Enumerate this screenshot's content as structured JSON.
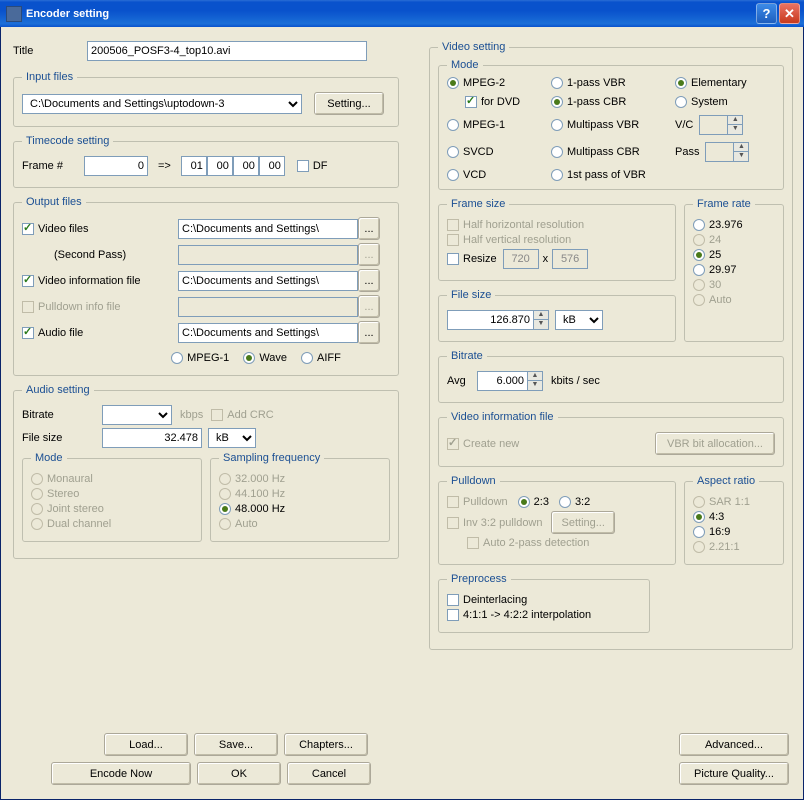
{
  "window": {
    "title": "Encoder setting"
  },
  "title_label": "Title",
  "title_value": "200506_POSF3-4_top10.avi",
  "input_files": {
    "legend": "Input files",
    "path": "C:\\Documents and Settings\\uptodown-3",
    "setting_btn": "Setting..."
  },
  "timecode": {
    "legend": "Timecode setting",
    "frame_label": "Frame #",
    "frame_value": "0",
    "arrow": "=>",
    "h": "01",
    "m": "00",
    "s": "00",
    "f": "00",
    "df_label": "DF"
  },
  "output_files": {
    "legend": "Output files",
    "video_files_label": "Video files",
    "second_pass": "(Second Pass)",
    "video_files_path": "C:\\Documents and Settings\\",
    "video_info_label": "Video information file",
    "video_info_path": "C:\\Documents and Settings\\",
    "pulldown_info_label": "Pulldown info file",
    "audio_file_label": "Audio file",
    "audio_file_path": "C:\\Documents and Settings\\",
    "audio_fmt_mpeg1": "MPEG-1",
    "audio_fmt_wave": "Wave",
    "audio_fmt_aiff": "AIFF"
  },
  "audio_setting": {
    "legend": "Audio setting",
    "bitrate_label": "Bitrate",
    "kbps": "kbps",
    "add_crc": "Add CRC",
    "file_size_label": "File size",
    "file_size_value": "32.478",
    "file_size_unit": "kB",
    "mode_legend": "Mode",
    "mode_monaural": "Monaural",
    "mode_stereo": "Stereo",
    "mode_joint": "Joint stereo",
    "mode_dual": "Dual channel",
    "sampling_legend": "Sampling frequency",
    "s32": "32.000 Hz",
    "s44": "44.100 Hz",
    "s48": "48.000 Hz",
    "s_auto": "Auto"
  },
  "video_setting": {
    "legend": "Video setting",
    "mode_legend": "Mode",
    "mpeg2": "MPEG-2",
    "for_dvd": "for DVD",
    "mpeg1": "MPEG-1",
    "svcd": "SVCD",
    "vcd": "VCD",
    "vbr1": "1-pass VBR",
    "cbr1": "1-pass CBR",
    "mvbr": "Multipass VBR",
    "mcbr": "Multipass CBR",
    "first_vbr": "1st pass of VBR",
    "elementary": "Elementary",
    "system": "System",
    "vc_label": "V/C",
    "pass_label": "Pass"
  },
  "frame_size": {
    "legend": "Frame size",
    "half_h": "Half horizontal resolution",
    "half_v": "Half vertical resolution",
    "resize": "Resize",
    "w": "720",
    "h": "576"
  },
  "frame_rate": {
    "legend": "Frame rate",
    "r23": "23.976",
    "r24": "24",
    "r25": "25",
    "r29": "29.97",
    "r30": "30",
    "r_auto": "Auto"
  },
  "file_size": {
    "legend": "File size",
    "value": "126.870",
    "unit": "kB"
  },
  "bitrate": {
    "legend": "Bitrate",
    "avg_label": "Avg",
    "value": "6.000",
    "unit": "kbits / sec"
  },
  "video_info_file": {
    "legend": "Video information file",
    "create_new": "Create new",
    "vbr_btn": "VBR bit allocation..."
  },
  "pulldown": {
    "legend": "Pulldown",
    "pulldown": "Pulldown",
    "r23": "2:3",
    "r32": "3:2",
    "inv32": "Inv 3:2 pulldown",
    "setting_btn": "Setting...",
    "auto2pass": "Auto 2-pass detection"
  },
  "aspect": {
    "legend": "Aspect ratio",
    "sar": "SAR 1:1",
    "r43": "4:3",
    "r169": "16:9",
    "r221": "2.21:1"
  },
  "preprocess": {
    "legend": "Preprocess",
    "deint": "Deinterlacing",
    "interp": "4:1:1 -> 4:2:2 interpolation"
  },
  "buttons": {
    "load": "Load...",
    "save": "Save...",
    "chapters": "Chapters...",
    "encode_now": "Encode Now",
    "ok": "OK",
    "cancel": "Cancel",
    "advanced": "Advanced...",
    "picture_quality": "Picture Quality..."
  }
}
